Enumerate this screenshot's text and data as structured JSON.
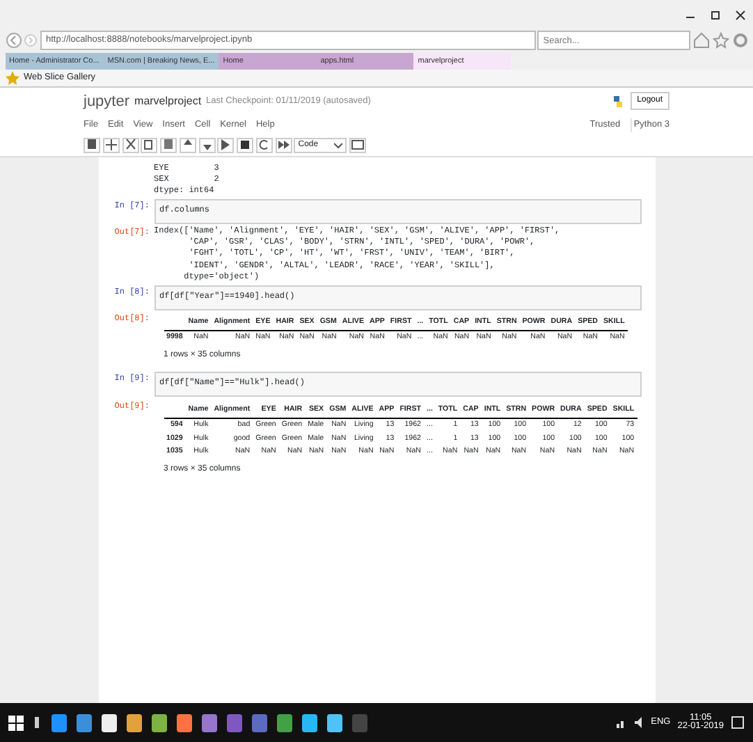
{
  "browser": {
    "url": "http://localhost:8888/notebooks/marvelproject.ipynb",
    "search_placeholder": "Search...",
    "tabs": [
      {
        "label": "Home - Administrator Co...",
        "selected": false
      },
      {
        "label": "MSN.com | Breaking News, E...",
        "selected": false
      },
      {
        "label": "Home",
        "selected": false
      },
      {
        "label": "apps.html",
        "selected": false
      },
      {
        "label": "marvelproject",
        "selected": true
      }
    ],
    "favorites": [
      "Web Slice Gallery"
    ]
  },
  "notebook": {
    "logo": "jupyter",
    "title": "marvelproject",
    "checkpoint": "Last Checkpoint: 01/11/2019 (autosaved)",
    "logout": "Logout",
    "menu": [
      "File",
      "Edit",
      "View",
      "Insert",
      "Cell",
      "Kernel",
      "Help"
    ],
    "trusted": "Trusted",
    "kernel": "Python 3",
    "cell_type": "Code"
  },
  "cells": [
    {
      "kind": "text_output",
      "lines": [
        "EYE         3",
        "SEX         2",
        "dtype: int64"
      ]
    },
    {
      "kind": "code",
      "prompt": "In [7]:",
      "code": "df.columns"
    },
    {
      "kind": "text_output",
      "prompt": "Out[7]:",
      "lines": [
        "Index(['Name', 'Alignment', 'EYE', 'HAIR', 'SEX', 'GSM', 'ALIVE', 'APP', 'FIRST',",
        "       'CAP', 'GSR', 'CLAS', 'BODY', 'STRN', 'INTL', 'SPED', 'DURA', 'POWR',",
        "       'FGHT', 'TOTL', 'CP', 'HT', 'WT', 'FRST', 'UNIV', 'TEAM', 'BIRT',",
        "       'IDENT', 'GENDR', 'ALTAL', 'LEADR', 'RACE', 'YEAR', 'SKILL'],",
        "      dtype='object')"
      ]
    },
    {
      "kind": "code",
      "prompt": "In [8]:",
      "code": "df[df[\"Year\"]==1940].head()"
    },
    {
      "kind": "table",
      "prompt": "Out[8]:",
      "columns": [
        "",
        "Name",
        "Alignment",
        "EYE",
        "HAIR",
        "SEX",
        "GSM",
        "ALIVE",
        "APP",
        "FIRST",
        "...",
        "TOTL",
        "CAP",
        "INTL",
        "STRN",
        "POWR",
        "DURA",
        "SPED",
        "SKILL"
      ],
      "rows": [
        [
          "9998",
          "NaN",
          "NaN",
          "NaN",
          "NaN",
          "NaN",
          "NaN",
          "NaN",
          "NaN",
          "NaN",
          "...",
          "NaN",
          "NaN",
          "NaN",
          "NaN",
          "NaN",
          "NaN",
          "NaN",
          "NaN"
        ]
      ],
      "footer": "1 rows × 35 columns"
    },
    {
      "kind": "code",
      "prompt": "In [9]:",
      "code": "df[df[\"Name\"]==\"Hulk\"].head()"
    },
    {
      "kind": "table",
      "prompt": "Out[9]:",
      "columns": [
        "",
        "Name",
        "Alignment",
        "EYE",
        "HAIR",
        "SEX",
        "GSM",
        "ALIVE",
        "APP",
        "FIRST",
        "...",
        "TOTL",
        "CAP",
        "INTL",
        "STRN",
        "POWR",
        "DURA",
        "SPED",
        "SKILL"
      ],
      "rows": [
        [
          "594",
          "Hulk",
          "bad",
          "Green",
          "Green",
          "Male",
          "NaN",
          "Living",
          "13",
          "1962",
          "...",
          "1",
          "13",
          "100",
          "100",
          "100",
          "12",
          "100",
          "73"
        ],
        [
          "1029",
          "Hulk",
          "good",
          "Green",
          "Green",
          "Male",
          "NaN",
          "Living",
          "13",
          "1962",
          "...",
          "1",
          "13",
          "100",
          "100",
          "100",
          "100",
          "100",
          "100"
        ],
        [
          "1035",
          "Hulk",
          "NaN",
          "NaN",
          "NaN",
          "NaN",
          "NaN",
          "NaN",
          "NaN",
          "NaN",
          "...",
          "NaN",
          "NaN",
          "NaN",
          "NaN",
          "NaN",
          "NaN",
          "NaN",
          "NaN"
        ]
      ],
      "footer": "3 rows × 35 columns"
    }
  ],
  "taskbar": {
    "language": "ENG",
    "time": "11:05",
    "date": "22-01-2019"
  }
}
